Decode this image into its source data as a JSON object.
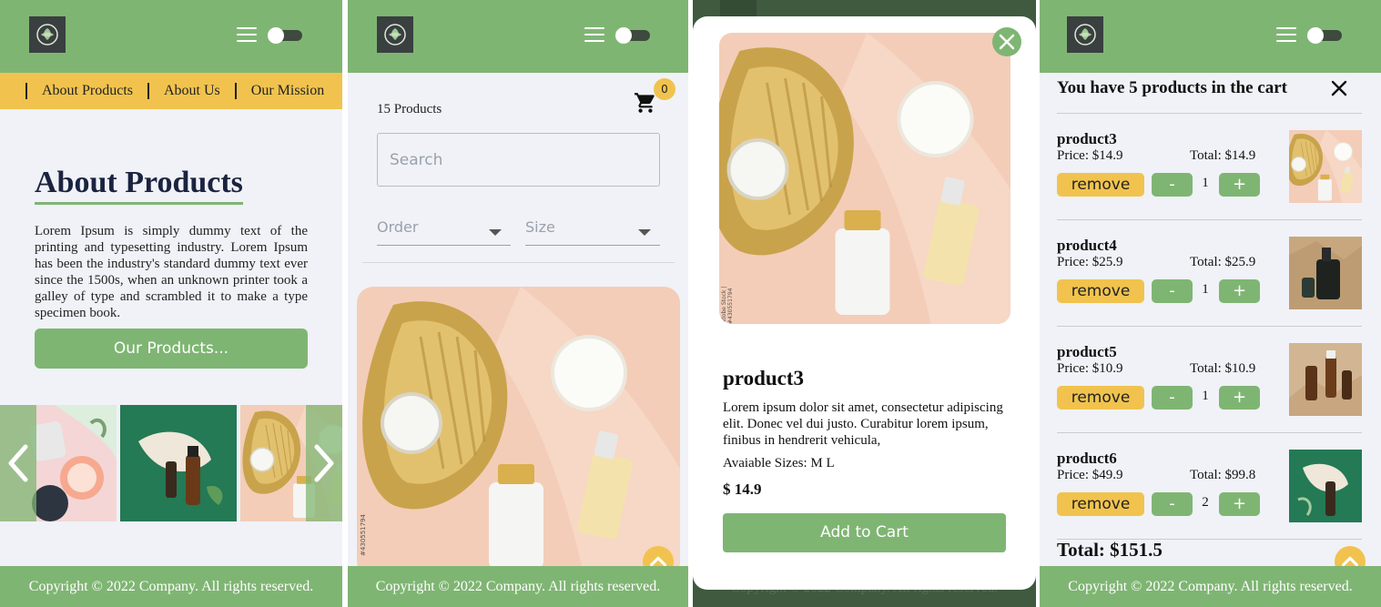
{
  "colors": {
    "green": "#7fb573",
    "yellow": "#f1c34e",
    "dark": "#3a3f40",
    "background": "#f0f2f7",
    "overlay": "#3f5a3f"
  },
  "icons": {
    "logo": "leaf-logo-icon",
    "menu": "hamburger-menu-icon",
    "theme": "toggle-switch-icon",
    "cart": "shopping-cart-icon",
    "close": "close-icon",
    "scroll_up": "chevron-up-icon",
    "prev": "chevron-left-icon",
    "next": "chevron-right-icon"
  },
  "footer": {
    "copyright": "Copyright © 2022 Company. All rights reserved."
  },
  "about_page": {
    "subnav": [
      "About Products",
      "About Us",
      "Our Mission"
    ],
    "title": "About Products",
    "text": "Lorem Ipsum is simply dummy text of the printing and typesetting industry. Lorem Ipsum has been the industry's standard dummy text ever since the 1500s, when an unknown printer took a galley of type and scrambled it to make a type specimen book.",
    "cta": "Our Products..."
  },
  "products_page": {
    "count_label": "15 Products",
    "cart_count": "0",
    "search_placeholder": "Search",
    "order_label": "Order",
    "size_label": "Size",
    "stock_mark": "#430551794"
  },
  "product_modal": {
    "name": "product3",
    "description": "Lorem ipsum dolor sit amet, consectetur adipiscing elit. Donec vel dui justo. Curabitur lorem ipsum, finibus in hendrerit vehicula,",
    "sizes": "Avaiable Sizes: M L",
    "price": "$ 14.9",
    "add_button": "Add to Cart",
    "stock_mark": "Adobe Stock | #430551794",
    "background_footer": "Copyright © 2022 Company. All rights reserved."
  },
  "cart_page": {
    "title": "You have 5 products in the cart",
    "remove_label": "remove",
    "minus_label": "-",
    "plus_label": "+",
    "items": [
      {
        "name": "product3",
        "price": "Price: $14.9",
        "total": "Total: $14.9",
        "qty": "1"
      },
      {
        "name": "product4",
        "price": "Price: $25.9",
        "total": "Total: $25.9",
        "qty": "1"
      },
      {
        "name": "product5",
        "price": "Price: $10.9",
        "total": "Total: $10.9",
        "qty": "1"
      },
      {
        "name": "product6",
        "price": "Price: $49.9",
        "total": "Total: $99.8",
        "qty": "2"
      }
    ],
    "total": "Total: $151.5"
  }
}
